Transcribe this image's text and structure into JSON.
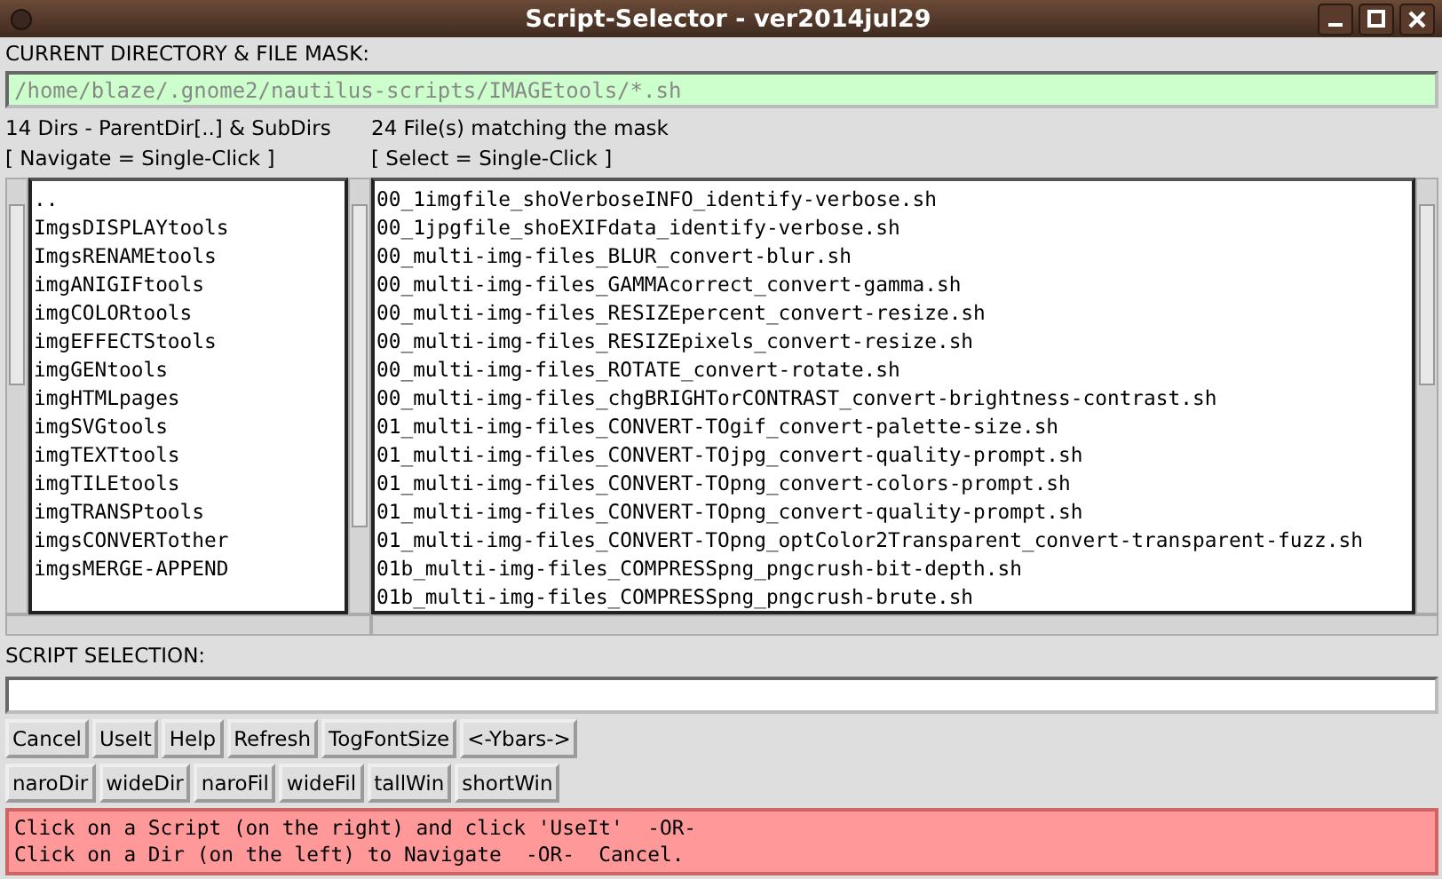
{
  "window": {
    "title": "Script-Selector - ver2014jul29"
  },
  "directory": {
    "label": "CURRENT DIRECTORY & FILE MASK:",
    "value": "/home/blaze/.gnome2/nautilus-scripts/IMAGEtools/*.sh"
  },
  "dirs": {
    "heading": "14 Dirs - ParentDir[..] & SubDirs",
    "hint": "[ Navigate = Single-Click ]",
    "items": [
      "..",
      "ImgsDISPLAYtools",
      "ImgsRENAMEtools",
      "imgANIGIFtools",
      "imgCOLORtools",
      "imgEFFECTStools",
      "imgGENtools",
      "imgHTMLpages",
      "imgSVGtools",
      "imgTEXTtools",
      "imgTILEtools",
      "imgTRANSPtools",
      "imgsCONVERTother",
      "imgsMERGE-APPEND"
    ]
  },
  "files": {
    "heading": "24 File(s) matching the mask",
    "hint": "[ Select = Single-Click ]",
    "items": [
      "00_1imgfile_shoVerboseINFO_identify-verbose.sh",
      "00_1jpgfile_shoEXIFdata_identify-verbose.sh",
      "00_multi-img-files_BLUR_convert-blur.sh",
      "00_multi-img-files_GAMMAcorrect_convert-gamma.sh",
      "00_multi-img-files_RESIZEpercent_convert-resize.sh",
      "00_multi-img-files_RESIZEpixels_convert-resize.sh",
      "00_multi-img-files_ROTATE_convert-rotate.sh",
      "00_multi-img-files_chgBRIGHTorCONTRAST_convert-brightness-contrast.sh",
      "01_multi-img-files_CONVERT-TOgif_convert-palette-size.sh",
      "01_multi-img-files_CONVERT-TOjpg_convert-quality-prompt.sh",
      "01_multi-img-files_CONVERT-TOpng_convert-colors-prompt.sh",
      "01_multi-img-files_CONVERT-TOpng_convert-quality-prompt.sh",
      "01_multi-img-files_CONVERT-TOpng_optColor2Transparent_convert-transparent-fuzz.sh",
      "01b_multi-img-files_COMPRESSpng_pngcrush-bit-depth.sh",
      "01b_multi-img-files_COMPRESSpng_pngcrush-brute.sh"
    ]
  },
  "selection": {
    "label": "SCRIPT SELECTION:"
  },
  "button_rows": [
    [
      "Cancel",
      "UseIt",
      "Help",
      "Refresh",
      "TogFontSize",
      "<-Ybars->"
    ],
    [
      "naroDir",
      "wideDir",
      "naroFil",
      "wideFil",
      "tallWin",
      "shortWin"
    ]
  ],
  "message": "Click on a Script (on the right) and click 'UseIt'  -OR-\nClick on a Dir (on the left) to Navigate  -OR-  Cancel."
}
